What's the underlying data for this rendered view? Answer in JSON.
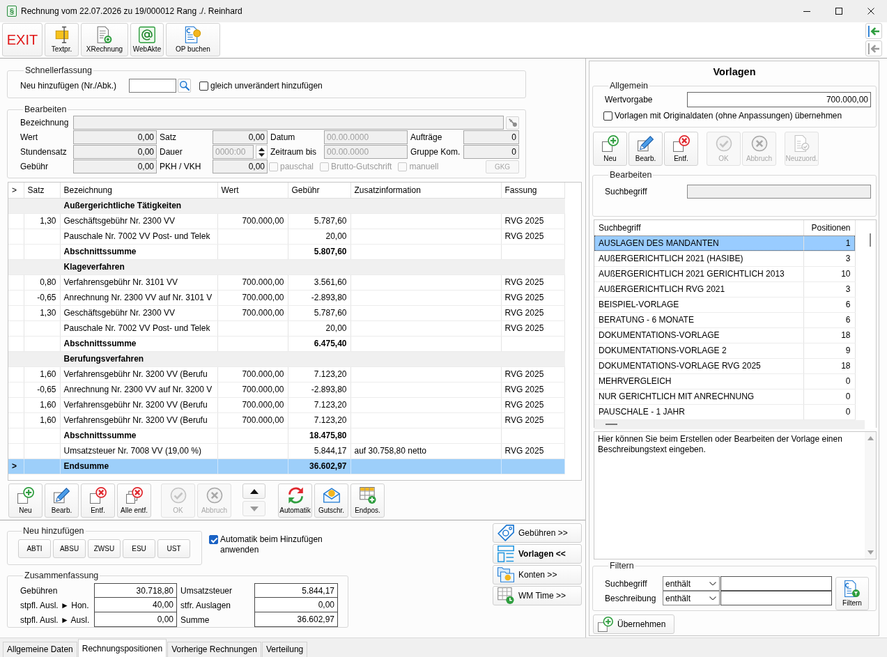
{
  "window": {
    "icon": "§",
    "title": "Rechnung vom 22.07.2026 zu 19/000012 Rang ./. Reinhard"
  },
  "toolbar": {
    "buttons": [
      {
        "kind": "exit",
        "label": "EXIT"
      },
      {
        "kind": "text-cursor",
        "label": "Textpr."
      },
      {
        "kind": "e-invoice",
        "label": "XRechnung"
      },
      {
        "kind": "web-file",
        "label": "WebAkte"
      },
      {
        "kind": "book-item",
        "label": "OP buchen"
      }
    ],
    "side_buttons": [
      {
        "disabled": false
      },
      {
        "disabled": true
      }
    ]
  },
  "quick_entry": {
    "legend": "Schnellerfassung",
    "label": "Neu hinzufügen (Nr./Abk.)",
    "checkbox": {
      "label": "gleich unverändert hinzufügen",
      "checked": false
    }
  },
  "edit": {
    "legend": "Bearbeiten",
    "name_label": "Bezeichnung",
    "rows": [
      [
        {
          "kind": "number",
          "label": "Wert",
          "value": "0,00"
        },
        {
          "kind": "number",
          "label": "Satz",
          "value": "0,00"
        },
        {
          "kind": "date",
          "label": "Datum",
          "placeholder": "00.00.0000"
        },
        {
          "kind": "number",
          "label": "Aufträge",
          "value": "0"
        }
      ],
      [
        {
          "kind": "number",
          "label": "Stundensatz",
          "value": "0,00"
        },
        {
          "kind": "spinner",
          "label": "Dauer",
          "placeholder": "0000:00"
        },
        {
          "kind": "date",
          "label": "Zeitraum bis",
          "placeholder": "00.00.0000"
        },
        {
          "kind": "number",
          "label": "Gruppe Kom.",
          "value": "0"
        }
      ],
      [
        {
          "kind": "number",
          "label": "Gebühr",
          "value": "0,00"
        },
        {
          "kind": "number",
          "label": "PKH / VKH",
          "value": "0,00"
        }
      ]
    ],
    "options": [
      {
        "label": "pauschal",
        "checked": false,
        "disabled": true
      },
      {
        "label": "Brutto-Gutschrift",
        "checked": false,
        "disabled": true
      },
      {
        "label": "manuell",
        "checked": false,
        "disabled": true
      }
    ],
    "gkg_button": {
      "label": "GKG",
      "disabled": true
    }
  },
  "positions": {
    "columns": [
      ">",
      "Satz",
      "Bezeichnung",
      "Wert",
      "Gebühr",
      "Zusatzinformation",
      "Fassung"
    ],
    "rows": [
      {
        "kind": "section",
        "selected": false,
        "name": "Außergerichtliche Tätigkeiten"
      },
      {
        "kind": "item",
        "selected": false,
        "rate": "1,30",
        "name": "Geschäftsgebühr Nr. 2300 VV",
        "value": "700.000,00",
        "fee": "5.787,60",
        "version": "RVG 2025"
      },
      {
        "kind": "item",
        "selected": false,
        "name": "Pauschale Nr. 7002 VV Post- und Telek",
        "fee": "20,00",
        "version": "RVG 2025"
      },
      {
        "kind": "subtotal",
        "selected": false,
        "name": "Abschnittssumme",
        "fee": "5.807,60"
      },
      {
        "kind": "section",
        "selected": false,
        "name": "Klageverfahren"
      },
      {
        "kind": "item",
        "selected": false,
        "rate": "0,80",
        "name": "Verfahrensgebühr Nr. 3101 VV",
        "value": "700.000,00",
        "fee": "3.561,60",
        "version": "RVG 2025"
      },
      {
        "kind": "item",
        "selected": false,
        "rate": "-0,65",
        "name": "Anrechnung Nr. 2300 VV auf Nr. 3101 V",
        "value": "700.000,00",
        "fee": "-2.893,80",
        "version": "RVG 2025"
      },
      {
        "kind": "item",
        "selected": false,
        "rate": "1,30",
        "name": "Geschäftsgebühr Nr. 2300 VV",
        "value": "700.000,00",
        "fee": "5.787,60",
        "version": "RVG 2025"
      },
      {
        "kind": "item",
        "selected": false,
        "name": "Pauschale Nr. 7002 VV Post- und Telek",
        "fee": "20,00",
        "version": "RVG 2025"
      },
      {
        "kind": "subtotal",
        "selected": false,
        "name": "Abschnittssumme",
        "fee": "6.475,40"
      },
      {
        "kind": "section",
        "selected": false,
        "name": "Berufungsverfahren"
      },
      {
        "kind": "item",
        "selected": false,
        "rate": "1,60",
        "name": "Verfahrensgebühr Nr. 3200 VV (Berufu",
        "value": "700.000,00",
        "fee": "7.123,20",
        "version": "RVG 2025"
      },
      {
        "kind": "item",
        "selected": false,
        "rate": "-0,65",
        "name": "Anrechnung Nr. 2300 VV auf Nr. 3200 V",
        "value": "700.000,00",
        "fee": "-2.893,80",
        "version": "RVG 2025"
      },
      {
        "kind": "item",
        "selected": false,
        "rate": "1,60",
        "name": "Verfahrensgebühr Nr. 3200 VV (Berufu",
        "value": "700.000,00",
        "fee": "7.123,20",
        "version": "RVG 2025"
      },
      {
        "kind": "item",
        "selected": false,
        "rate": "1,60",
        "name": "Verfahrensgebühr Nr. 3200 VV (Berufu",
        "value": "700.000,00",
        "fee": "7.123,20",
        "version": "RVG 2025"
      },
      {
        "kind": "subtotal",
        "selected": false,
        "name": "Abschnittssumme",
        "fee": "18.475,80"
      },
      {
        "kind": "item",
        "selected": false,
        "name": "Umsatzsteuer Nr. 7008 VV (19,00 %)",
        "fee": "5.844,17",
        "info": "auf 30.758,80 netto",
        "version": "RVG 2025"
      },
      {
        "kind": "total",
        "selected": true,
        "marker": ">",
        "name": "Endsumme",
        "fee": "36.602,97"
      }
    ]
  },
  "position_toolbar": {
    "groups": [
      [
        {
          "kind": "new",
          "label": "Neu",
          "disabled": false
        },
        {
          "kind": "edit",
          "label": "Bearb.",
          "disabled": false
        },
        {
          "kind": "delete",
          "label": "Entf.",
          "disabled": false
        },
        {
          "kind": "delete-all",
          "label": "Alle entf.",
          "disabled": false
        }
      ],
      [
        {
          "kind": "ok",
          "label": "OK",
          "disabled": true
        },
        {
          "kind": "cancel",
          "label": "Abbruch",
          "disabled": true
        }
      ],
      [
        {
          "kind": "up",
          "disabled": false
        },
        {
          "kind": "down",
          "disabled": true
        }
      ],
      [
        {
          "kind": "auto",
          "label": "Automatik",
          "disabled": false
        },
        {
          "kind": "credit",
          "label": "Gutschr.",
          "disabled": false
        },
        {
          "kind": "final",
          "label": "Endpos.",
          "disabled": false
        }
      ]
    ]
  },
  "quick_add": {
    "legend": "Neu hinzufügen",
    "buttons": [
      "ABTI",
      "ABSU",
      "ZWSU",
      "ESU",
      "UST"
    ]
  },
  "auto_apply": {
    "label": "Automatik beim Hinzufügen anwenden",
    "checked": true
  },
  "summary": {
    "legend": "Zusammenfassung",
    "rows": [
      [
        {
          "label": "Gebühren",
          "value": "30.718,80"
        },
        {
          "label": "Umsatzsteuer",
          "value": "5.844,17"
        }
      ],
      [
        {
          "label": "stpfl. Ausl. ► Hon.",
          "value": "40,00"
        },
        {
          "label": "stfr. Auslagen",
          "value": "0,00"
        }
      ],
      [
        {
          "label": "stpfl. Ausl. ► Ausl.",
          "value": "0,00"
        },
        {
          "label": "Summe",
          "value": "36.602,97"
        }
      ]
    ]
  },
  "panel_buttons": [
    {
      "kind": "fees",
      "label": "Gebühren >>",
      "selected": false
    },
    {
      "kind": "templates",
      "label": "Vorlagen <<",
      "selected": true
    },
    {
      "kind": "accounts",
      "label": "Konten >>",
      "selected": false
    },
    {
      "kind": "time",
      "label": "WM Time >>",
      "selected": false
    }
  ],
  "tabs": [
    {
      "label": "Allgemeine Daten",
      "selected": false
    },
    {
      "label": "Rechnungspositionen",
      "selected": true
    },
    {
      "label": "Vorherige Rechnungen",
      "selected": false
    },
    {
      "label": "Verteilung",
      "selected": false
    }
  ],
  "templates": {
    "title": "Vorlagen",
    "general": {
      "legend": "Allgemein",
      "label": "Wertvorgabe",
      "value": "700.000,00",
      "checkbox": {
        "label": "Vorlagen mit Originaldaten (ohne Anpassungen) übernehmen",
        "checked": false
      }
    },
    "toolbar": {
      "groups": [
        [
          {
            "kind": "new",
            "label": "Neu",
            "disabled": false
          },
          {
            "kind": "edit",
            "label": "Bearb.",
            "disabled": false
          },
          {
            "kind": "delete",
            "label": "Entf.",
            "disabled": false
          }
        ],
        [
          {
            "kind": "ok",
            "label": "OK",
            "disabled": true
          },
          {
            "kind": "cancel",
            "label": "Abbruch",
            "disabled": true
          }
        ],
        [
          {
            "kind": "reassign",
            "label": "Neuzuord.",
            "disabled": true
          }
        ]
      ]
    },
    "edit": {
      "legend": "Bearbeiten",
      "label": "Suchbegriff",
      "disabled": true
    },
    "list": {
      "columns": [
        "Suchbegriff",
        "Positionen"
      ],
      "rows": [
        {
          "name": "AUSLAGEN DES MANDANTEN",
          "count": "1",
          "selected": true
        },
        {
          "name": "AUßERGERICHTLICH 2021 (HASIBE)",
          "count": "3",
          "selected": false
        },
        {
          "name": "AUßERGERICHTLICH 2021 GERICHTLICH 2013",
          "count": "10",
          "selected": false
        },
        {
          "name": "AUßERGERICHTLICH RVG 2021",
          "count": "3",
          "selected": false
        },
        {
          "name": "BEISPIEL-VORLAGE",
          "count": "6",
          "selected": false
        },
        {
          "name": "BERATUNG - 6 MONATE",
          "count": "6",
          "selected": false
        },
        {
          "name": "DOKUMENTATIONS-VORLAGE",
          "count": "18",
          "selected": false
        },
        {
          "name": "DOKUMENTATIONS-VORLAGE 2",
          "count": "9",
          "selected": false
        },
        {
          "name": "DOKUMENTATIONS-VORLAGE RVG 2025",
          "count": "18",
          "selected": false
        },
        {
          "name": "MEHRVERGLEICH",
          "count": "0",
          "selected": false
        },
        {
          "name": "NUR GERICHTLICH MIT ANRECHNUNG",
          "count": "0",
          "selected": false
        },
        {
          "name": "PAUSCHALE - 1 JAHR",
          "count": "0",
          "selected": false
        }
      ]
    },
    "description": "Hier können Sie beim Erstellen oder Bearbeiten der Vorlage einen Beschreibungstext eingeben.",
    "filter": {
      "legend": "Filtern",
      "rows": [
        {
          "label": "Suchbegriff",
          "operator": "enthält"
        },
        {
          "label": "Beschreibung",
          "operator": "enthält"
        }
      ],
      "button": "Filtern"
    },
    "apply_button": "Übernehmen"
  }
}
